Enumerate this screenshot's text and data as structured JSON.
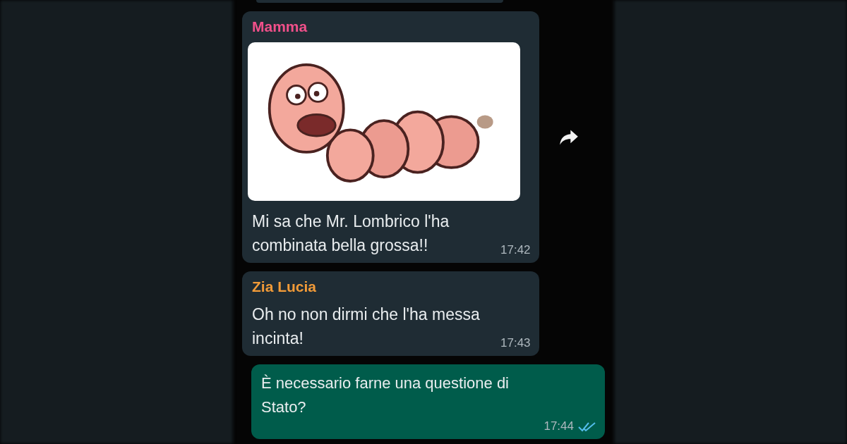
{
  "messages": [
    {
      "kind": "incoming",
      "sender": "Mamma",
      "color": "#f0508a",
      "image": true,
      "text": "Mi sa che Mr. Lombrico l'ha combinata bella grossa!!",
      "time": "17:42"
    },
    {
      "kind": "incoming",
      "sender": "Zia Lucia",
      "color": "#f29b38",
      "image": false,
      "text": "Oh no non dirmi che l'ha messa incinta!",
      "time": "17:43"
    },
    {
      "kind": "outgoing",
      "text": "È necessario farne una questione di Stato?",
      "time": "17:44",
      "read": true
    }
  ]
}
